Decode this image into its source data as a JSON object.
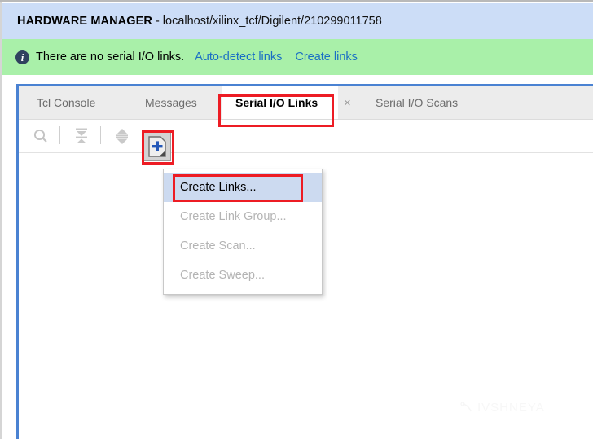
{
  "header": {
    "title_strong": "HARDWARE MANAGER",
    "title_rest": "- localhost/xilinx_tcf/Digilent/210299011758",
    "background_color": "#ccddf7"
  },
  "info_banner": {
    "icon": "info-icon",
    "icon_glyph": "i",
    "message": "There are no serial I/O links.",
    "links": [
      {
        "label": "Auto-detect links"
      },
      {
        "label": "Create links"
      }
    ],
    "background_color": "#a9f0a9",
    "link_color": "#1a6fc4"
  },
  "panel": {
    "border_color": "#4a82d2",
    "tabs": [
      {
        "label": "Tcl Console",
        "active": false
      },
      {
        "label": "Messages",
        "active": false
      },
      {
        "label": "Serial I/O Links",
        "active": true,
        "close_glyph": "×"
      },
      {
        "label": "Serial I/O Scans",
        "active": false
      }
    ],
    "toolbar": {
      "items": [
        {
          "name": "search-icon",
          "title": "Search"
        },
        {
          "name": "collapse-all-icon",
          "title": "Collapse All"
        },
        {
          "name": "expand-all-icon",
          "title": "Expand All"
        },
        {
          "name": "add-new-icon",
          "title": "Create Links"
        }
      ]
    }
  },
  "popup_menu": {
    "items": [
      {
        "label": "Create Links...",
        "enabled": true,
        "highlighted": true
      },
      {
        "label": "Create Link Group...",
        "enabled": false,
        "highlighted": false
      },
      {
        "label": "Create Scan...",
        "enabled": false,
        "highlighted": false
      },
      {
        "label": "Create Sweep...",
        "enabled": false,
        "highlighted": false
      }
    ],
    "highlight_color": "#ccdaf0",
    "disabled_color": "#b4b4b4"
  },
  "annotations": {
    "color": "#ed1c24",
    "boxes": [
      {
        "name": "annotation-active-tab"
      },
      {
        "name": "annotation-add-button"
      },
      {
        "name": "annotation-create-links-item"
      }
    ]
  },
  "watermark": {
    "text": "IVSHNEYA"
  }
}
